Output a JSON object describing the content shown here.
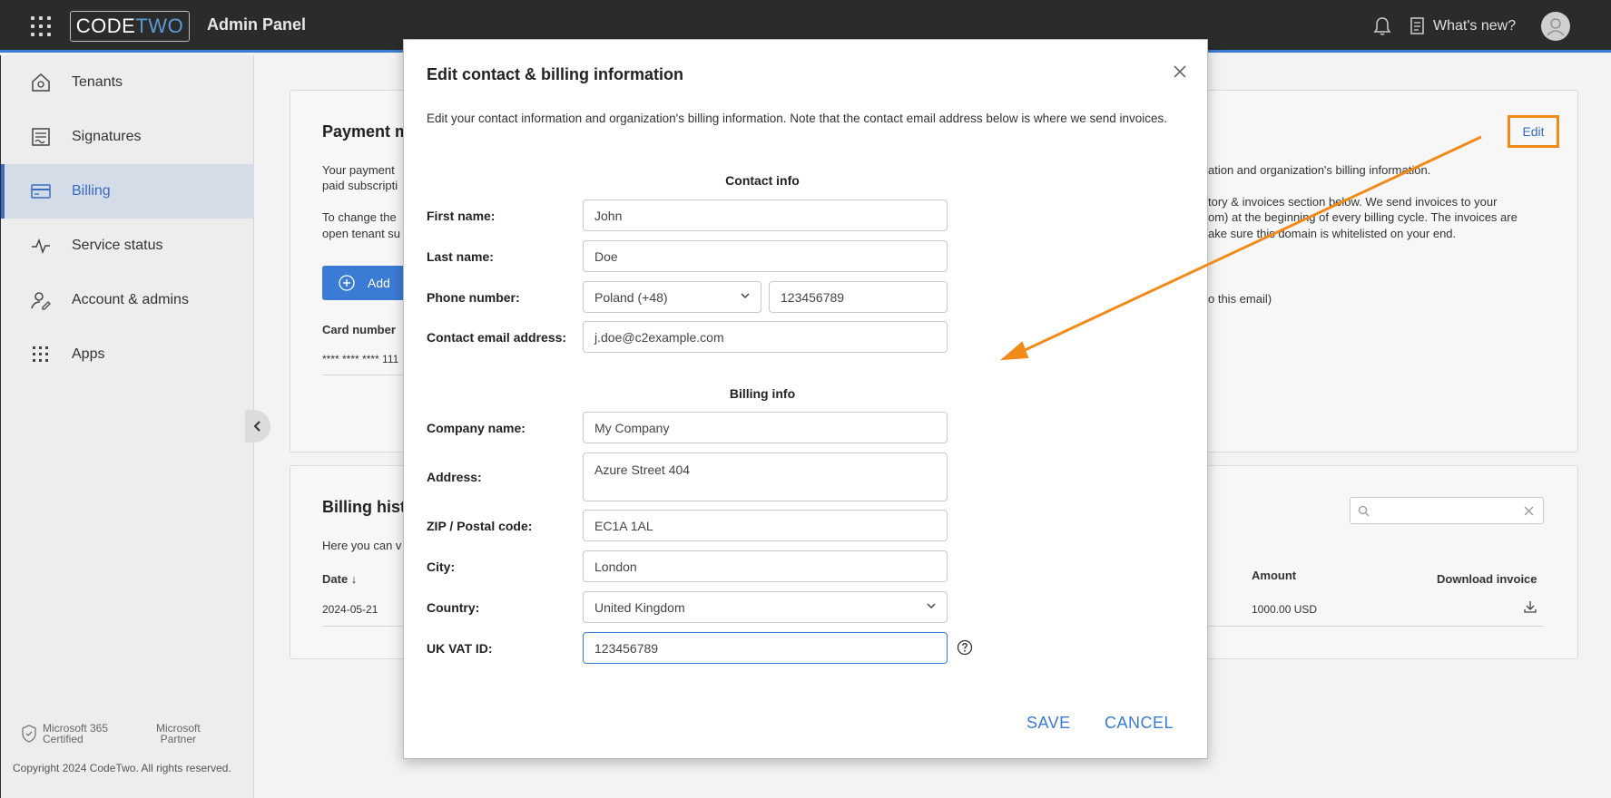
{
  "topbar": {
    "logo_code": "CODE",
    "logo_two": "TWO",
    "app_title": "Admin Panel",
    "whats_new": "What's new?"
  },
  "sidebar": {
    "items": [
      {
        "label": "Tenants",
        "icon": "home-icon"
      },
      {
        "label": "Signatures",
        "icon": "signature-icon"
      },
      {
        "label": "Billing",
        "icon": "credit-card-icon",
        "active": true
      },
      {
        "label": "Service status",
        "icon": "pulse-icon"
      },
      {
        "label": "Account & admins",
        "icon": "user-edit-icon"
      },
      {
        "label": "Apps",
        "icon": "apps-grid-icon"
      }
    ],
    "cert_line1": "Microsoft 365",
    "cert_line2": "Certified",
    "partner_line1": "Microsoft",
    "partner_line2": "Partner",
    "copyright": "Copyright 2024 CodeTwo. All rights reserved."
  },
  "main": {
    "payment": {
      "title": "Payment m",
      "text_l1": "Your payment",
      "text_l2": "paid subscripti",
      "text_l3": "To change the",
      "text_l4": "open tenant su",
      "add_label": "Add",
      "card_number_label": "Card number",
      "card_number_value": "**** **** **** 111",
      "right_l1": "ation and organization's billing information.",
      "right_l2": "tory & invoices section below. We send invoices to your",
      "right_l3": "om) at the beginning of every billing cycle. The invoices are",
      "right_l4": "ake sure this domain is whitelisted on your end.",
      "right_l5": "o this email)",
      "edit_label": "Edit"
    },
    "history": {
      "title": "Billing hist",
      "text": "Here you can v",
      "col_date": "Date ↓",
      "col_amount": "Amount",
      "col_download": "Download invoice",
      "row_date": "2024-05-21",
      "row_amount": "1000.00 USD"
    }
  },
  "modal": {
    "title": "Edit contact & billing information",
    "description": "Edit your contact information and organization's billing information. Note that the contact email address below is where we send invoices.",
    "contact_heading": "Contact info",
    "billing_heading": "Billing info",
    "fields": {
      "first_name": {
        "label": "First name:",
        "value": "John"
      },
      "last_name": {
        "label": "Last name:",
        "value": "Doe"
      },
      "phone": {
        "label": "Phone number:",
        "country": "Poland (+48)",
        "value": "123456789"
      },
      "email": {
        "label": "Contact email address:",
        "value": "j.doe@c2example.com"
      },
      "company": {
        "label": "Company name:",
        "value": "My Company"
      },
      "address": {
        "label": "Address:",
        "value": "Azure Street 404"
      },
      "zip": {
        "label": "ZIP / Postal code:",
        "value": "EC1A 1AL"
      },
      "city": {
        "label": "City:",
        "value": "London"
      },
      "country": {
        "label": "Country:",
        "value": "United Kingdom"
      },
      "vat": {
        "label": "UK VAT ID:",
        "value": "123456789"
      }
    },
    "save_label": "SAVE",
    "cancel_label": "CANCEL"
  },
  "colors": {
    "accent": "#3a7bd5",
    "annotation": "#f28a1a",
    "topbar": "#2b2b2b"
  }
}
